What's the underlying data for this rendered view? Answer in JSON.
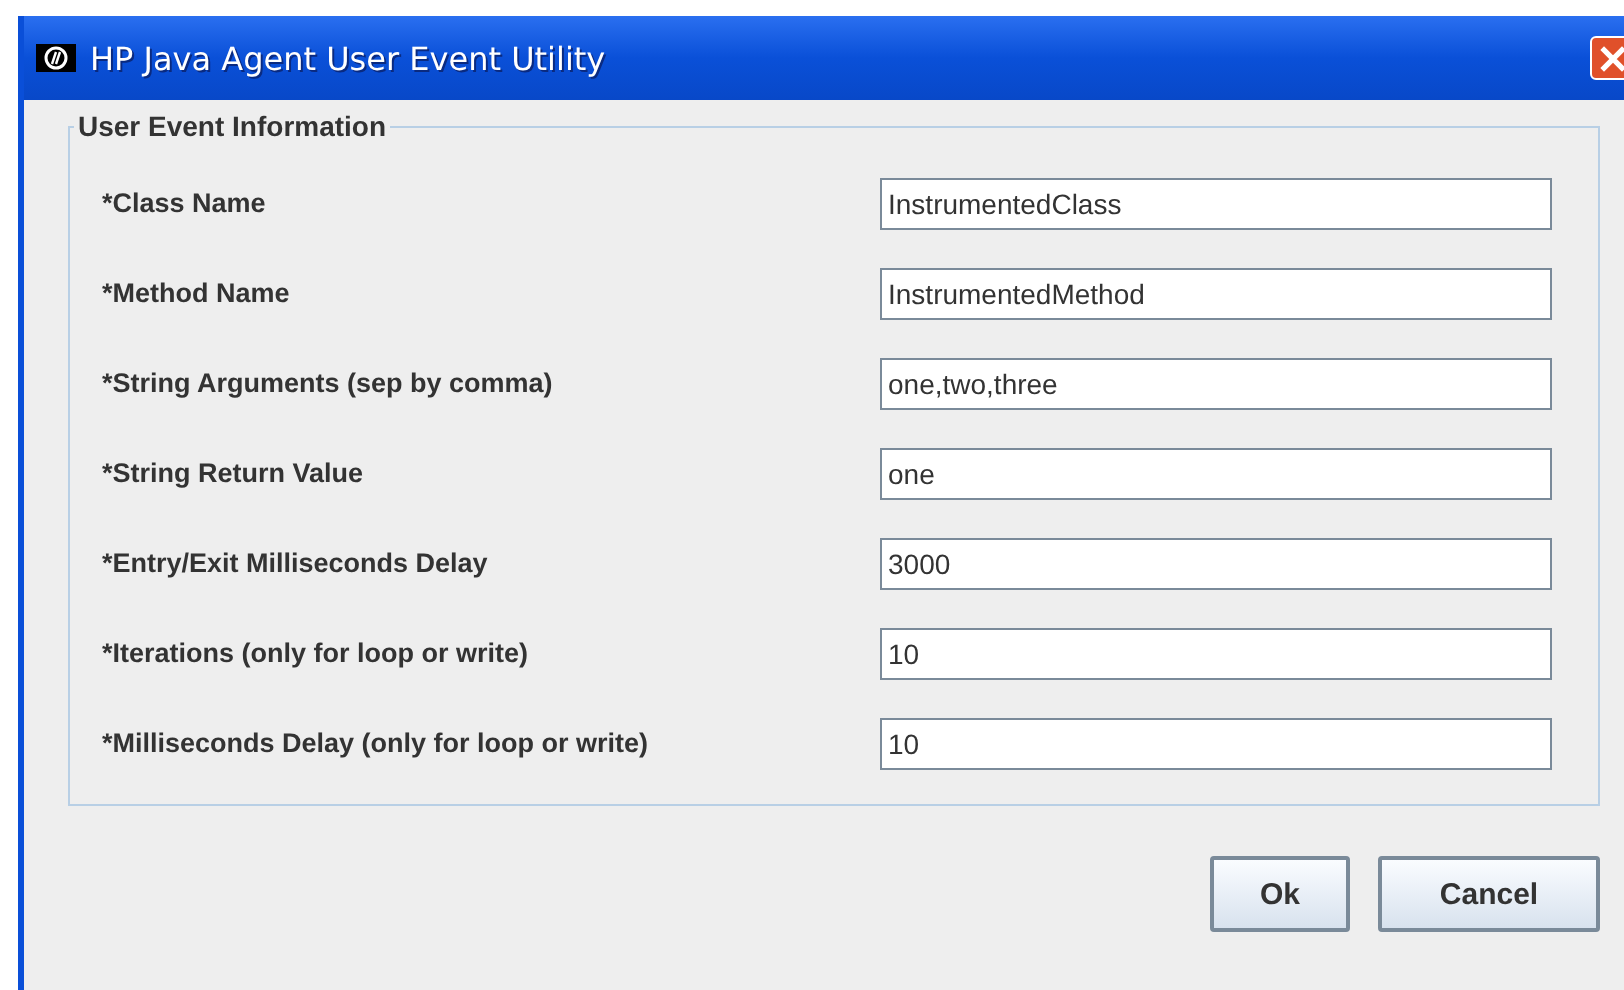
{
  "window": {
    "title": "HP Java Agent User Event Utility"
  },
  "group": {
    "title": "User Event Information"
  },
  "fields": [
    {
      "label": "*Class Name",
      "value": "InstrumentedClass"
    },
    {
      "label": "*Method Name",
      "value": "InstrumentedMethod"
    },
    {
      "label": "*String Arguments (sep by comma)",
      "value": "one,two,three"
    },
    {
      "label": "*String Return Value",
      "value": "one"
    },
    {
      "label": "*Entry/Exit Milliseconds Delay",
      "value": "3000"
    },
    {
      "label": "*Iterations (only for loop or write)",
      "value": "10"
    },
    {
      "label": "*Milliseconds Delay (only for loop or write)",
      "value": "10"
    }
  ],
  "buttons": [
    "Ok",
    "Cancel"
  ]
}
